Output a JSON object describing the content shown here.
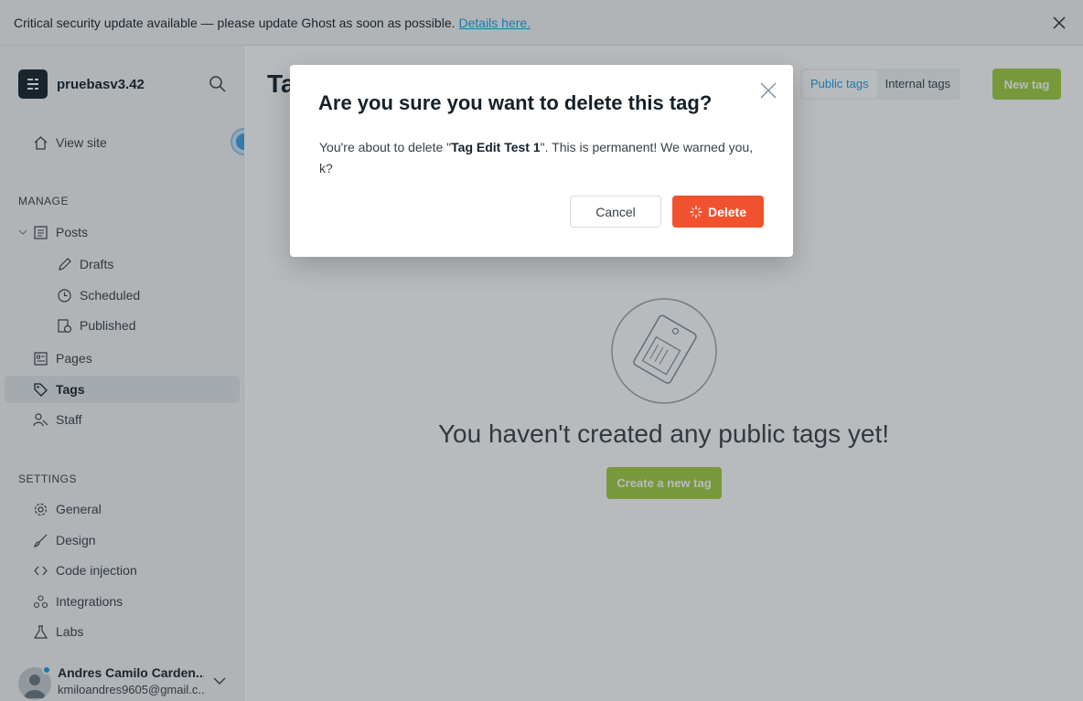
{
  "banner": {
    "message": "Critical security update available — please update Ghost as soon as possible.",
    "link": "Details here."
  },
  "sidebar": {
    "site_name": "pruebasv3.42",
    "view_site": "View site",
    "manage_title": "MANAGE",
    "settings_title": "SETTINGS",
    "items": {
      "posts": "Posts",
      "drafts": "Drafts",
      "scheduled": "Scheduled",
      "published": "Published",
      "pages": "Pages",
      "tags": "Tags",
      "staff": "Staff",
      "general": "General",
      "design": "Design",
      "code_injection": "Code injection",
      "integrations": "Integrations",
      "labs": "Labs"
    },
    "user": {
      "name": "Andres Camilo Carden...",
      "email": "kmiloandres9605@gmail.c..."
    }
  },
  "main": {
    "title": "Tags",
    "tabs": [
      "Public tags",
      "Internal tags"
    ],
    "new_tag": "New tag",
    "empty_title": "You haven't created any public tags yet!",
    "create_button": "Create a new tag"
  },
  "modal": {
    "title": "Are you sure you want to delete this tag?",
    "body_prefix": "You're about to delete \"",
    "tag_name": "Tag Edit Test 1",
    "body_suffix": "\". This is permanent! We warned you, k?",
    "cancel": "Cancel",
    "delete": "Delete"
  },
  "colors": {
    "accent": "#14a0eb",
    "green": "#9fcd41",
    "danger": "#f05230"
  }
}
